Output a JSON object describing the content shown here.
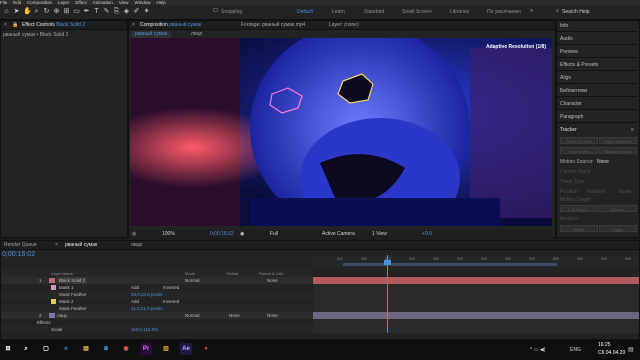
{
  "menu": [
    "File",
    "Edit",
    "Composition",
    "Layer",
    "Effect",
    "Animation",
    "View",
    "Window",
    "Help"
  ],
  "toolbar": {
    "snapping_label": "Snapping",
    "workspaces": [
      "Default",
      "Learn",
      "Standard",
      "Small Screen",
      "Libraries",
      "По умолчанию"
    ],
    "search_placeholder": "Search Help"
  },
  "effect_controls": {
    "tab_prefix": "Effect Controls",
    "tab_layer": "Black Solid 2",
    "breadcrumb": "рваный сумак • Black Solid 2"
  },
  "composition_panel": {
    "tab_prefix": "Composition",
    "tab_name": "рваный сумак",
    "footage_tab": "Footage: рваный сумак.mp4",
    "layer_tab": "Layer: (none)",
    "breadcrumb_comp": "рваный сумак",
    "breadcrumb_layer": "лицо",
    "adaptive_resolution": "Adaptive Resolution (1/8)"
  },
  "viewer_controls": {
    "zoom": "100%",
    "timecode": "0;00;16;02",
    "resolution": "Full",
    "camera": "Active Camera",
    "views": "1 View",
    "exposure": "+0.0"
  },
  "right_panel": {
    "items": [
      "Info",
      "Audio",
      "Preview",
      "Effects & Presets",
      "Align",
      "Библиотеки",
      "Character",
      "Paragraph"
    ],
    "tracker_title": "Tracker",
    "track_camera": "Track Camera",
    "warp_stabilizer": "Warp Stabilizer",
    "track_motion": "Track Motion",
    "stabilize_motion": "Stabilize Motion",
    "motion_source_label": "Motion Source:",
    "motion_source_value": "None",
    "current_track": "Current Track:",
    "track_type": "Track Type:",
    "position": "Position",
    "rotation": "Rotation",
    "scale": "Scale",
    "motion_target": "Motion Target:",
    "edit_target": "Edit Target...",
    "options": "Options...",
    "analyze": "Analyze:",
    "reset": "Reset",
    "apply": "Apply"
  },
  "timeline": {
    "render_queue_tab": "Render Queue",
    "comp_tab": "рваный сумак",
    "second_tab": "лицо",
    "timecode": "0;00:16:02",
    "columns": {
      "layer_name": "Layer Name",
      "mode": "Mode",
      "trkmat": "TrkMat",
      "parent": "Parent & Link"
    },
    "ruler_ticks": [
      "",
      "01f",
      "10f",
      "20f",
      "00f",
      "10f",
      "20f",
      "00f",
      "10f",
      "20f",
      "00f",
      "10f",
      "20f",
      "00f"
    ],
    "layers": [
      {
        "num": "1",
        "name": "Black Solid 2",
        "mode": "Normal",
        "parent": "None"
      },
      {
        "num": "",
        "name": "Mask 1",
        "mode": "Add",
        "inverted": "Inverted"
      },
      {
        "num": "",
        "name": "Mask Feather",
        "value": "34.0,34.0 pixels"
      },
      {
        "num": "",
        "name": "Mask 2",
        "mode": "Add",
        "inverted": "Inverted"
      },
      {
        "num": "",
        "name": "Mask Feather",
        "value": "21.0,21.0 pixels"
      },
      {
        "num": "2",
        "name": "лицо",
        "mode": "Normal",
        "trkmat": "None",
        "parent": "None"
      },
      {
        "num": "",
        "name": "Effects",
        "value": ""
      },
      {
        "num": "",
        "name": "Scale",
        "value": "110.0,110.0%"
      }
    ]
  },
  "taskbar": {
    "apps": [
      "Pr",
      "Ae"
    ],
    "tray_lang": "ENG",
    "time": "16:25",
    "date": "С6 04.04.20"
  }
}
